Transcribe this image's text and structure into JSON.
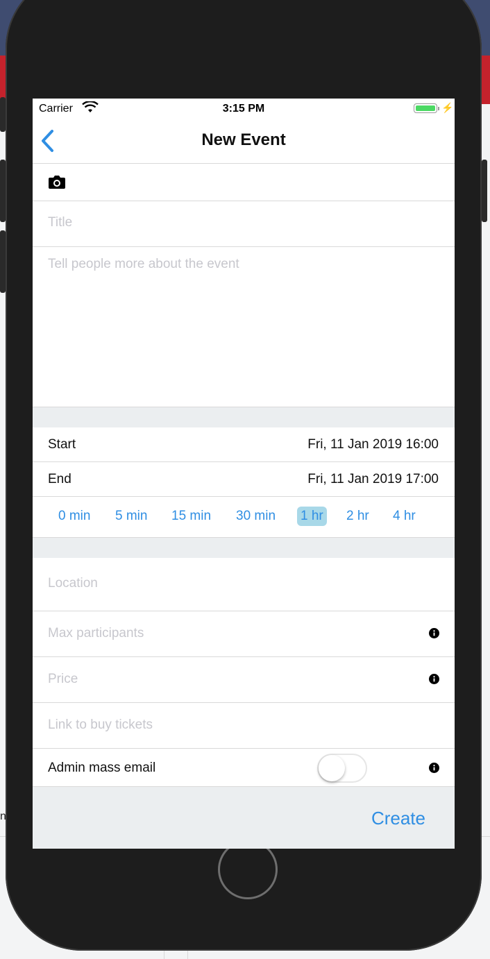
{
  "status_bar": {
    "carrier": "Carrier",
    "time": "3:15 PM"
  },
  "nav": {
    "title": "New Event"
  },
  "form": {
    "photo_icon": "camera-icon",
    "title_placeholder": "Title",
    "description_placeholder": "Tell people more about the event",
    "start": {
      "label": "Start",
      "value": "Fri, 11 Jan 2019 16:00"
    },
    "end": {
      "label": "End",
      "value": "Fri, 11 Jan 2019 17:00"
    },
    "durations": [
      "0 min",
      "5 min",
      "15 min",
      "30 min",
      "1 hr",
      "2 hr",
      "4 hr"
    ],
    "selected_duration": "1 hr",
    "location_placeholder": "Location",
    "max_participants_placeholder": "Max participants",
    "price_placeholder": "Price",
    "tickets_link_placeholder": "Link to buy tickets",
    "admin_mass_email": {
      "label": "Admin mass email",
      "enabled": false
    }
  },
  "footer": {
    "create_label": "Create"
  },
  "colors": {
    "accent": "#2f8ee3",
    "selected_bg": "#a8d8e8",
    "section_bg": "#ebeef0",
    "placeholder": "#c7c7cd"
  }
}
